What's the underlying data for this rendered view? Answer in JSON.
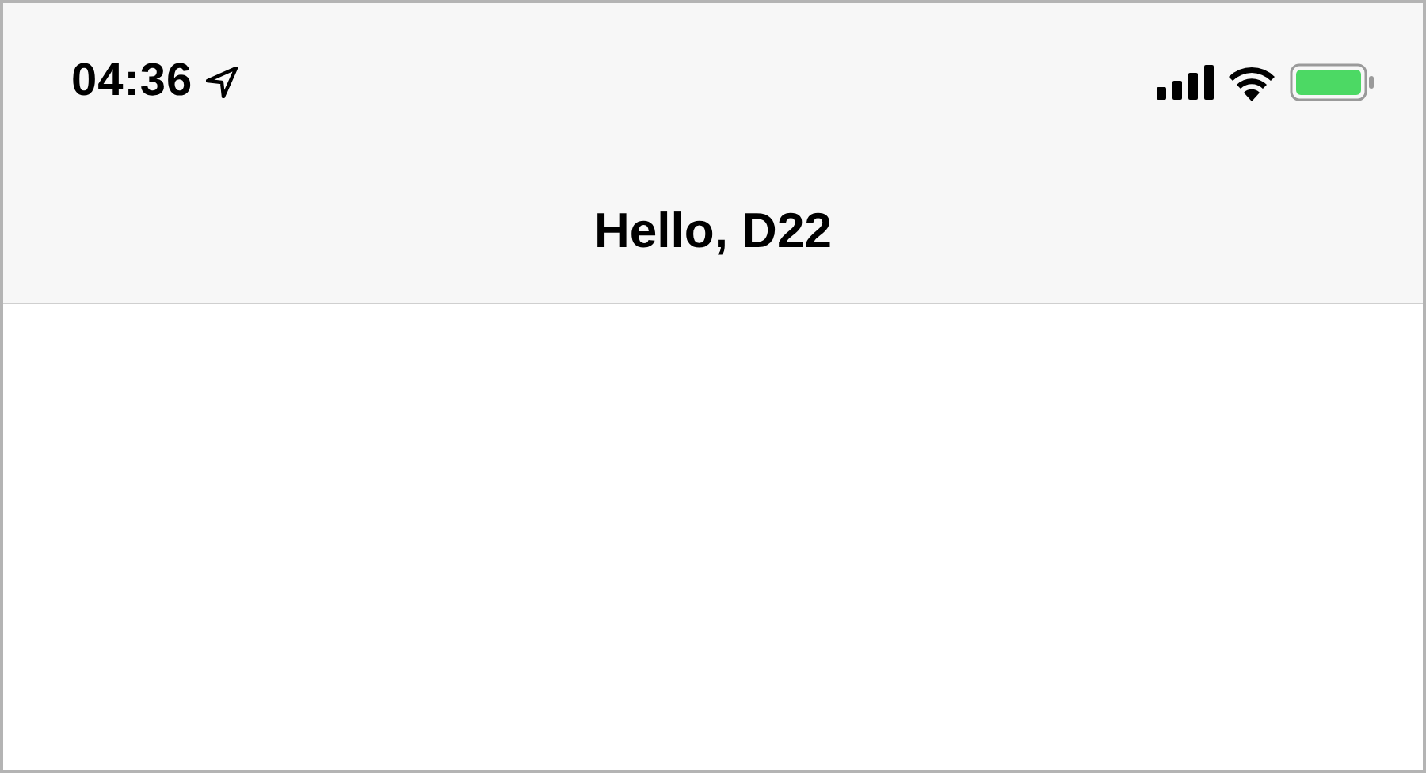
{
  "status_bar": {
    "time": "04:36"
  },
  "navigation_bar": {
    "title": "Hello, D22"
  }
}
